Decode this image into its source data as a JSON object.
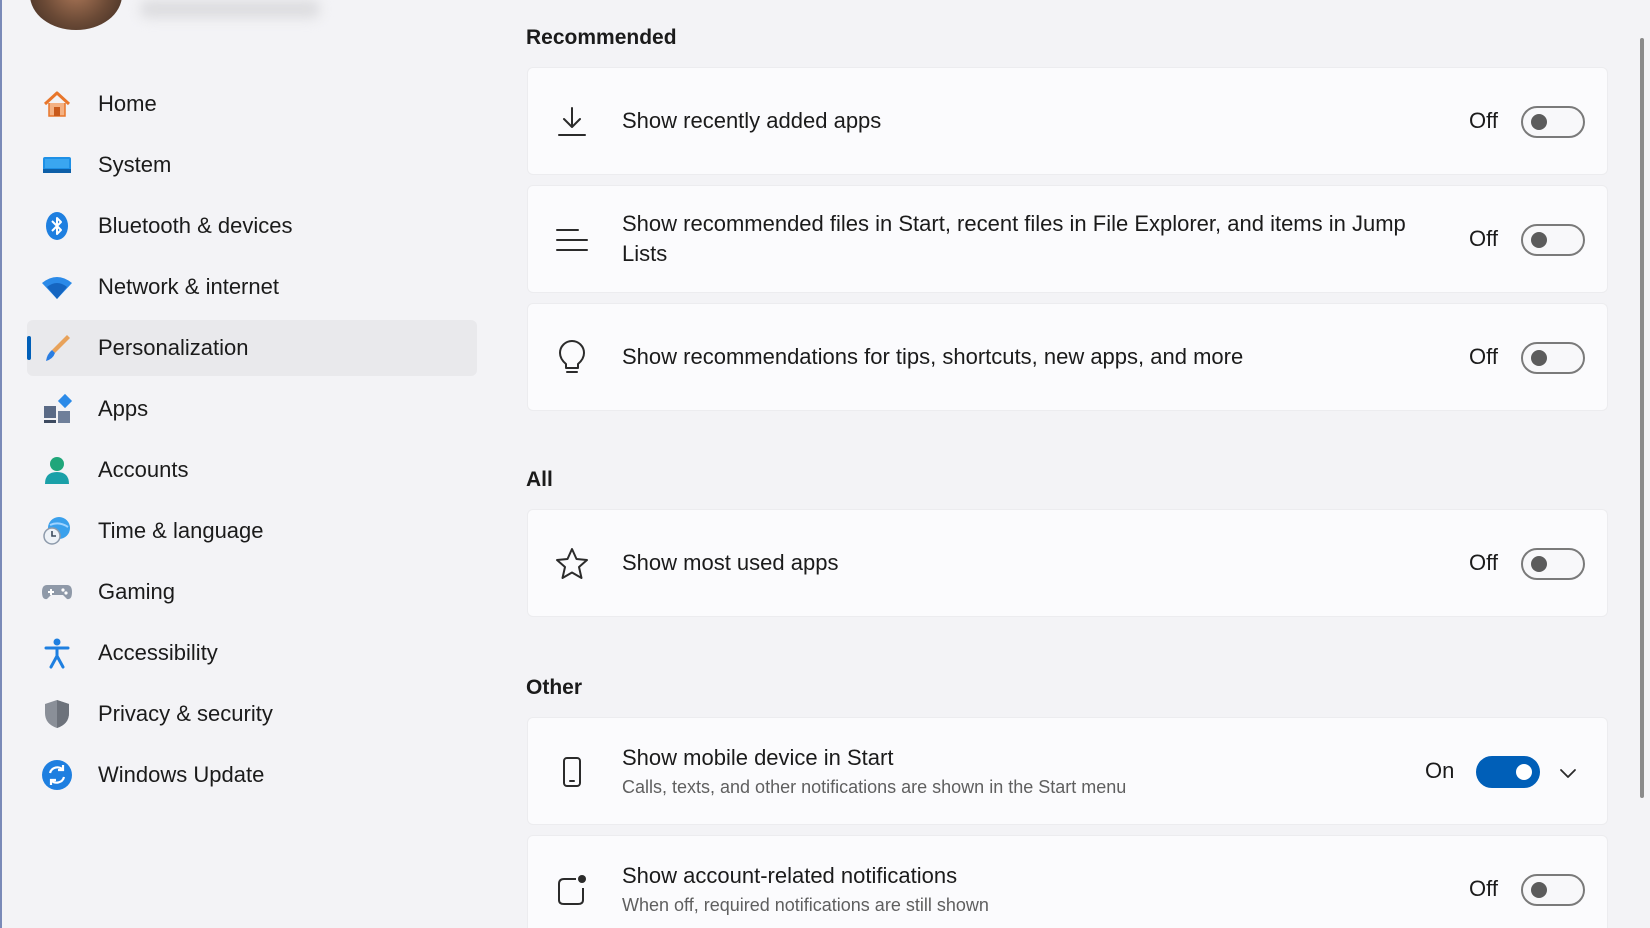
{
  "sidebar": {
    "items": [
      {
        "label": "Home",
        "icon": "home-icon"
      },
      {
        "label": "System",
        "icon": "system-icon"
      },
      {
        "label": "Bluetooth & devices",
        "icon": "bluetooth-icon"
      },
      {
        "label": "Network & internet",
        "icon": "wifi-icon"
      },
      {
        "label": "Personalization",
        "icon": "paintbrush-icon",
        "active": true
      },
      {
        "label": "Apps",
        "icon": "apps-icon"
      },
      {
        "label": "Accounts",
        "icon": "person-icon"
      },
      {
        "label": "Time & language",
        "icon": "globe-clock-icon"
      },
      {
        "label": "Gaming",
        "icon": "gamepad-icon"
      },
      {
        "label": "Accessibility",
        "icon": "accessibility-icon"
      },
      {
        "label": "Privacy & security",
        "icon": "shield-icon"
      },
      {
        "label": "Windows Update",
        "icon": "update-icon"
      }
    ]
  },
  "main": {
    "sections": {
      "recommended": "Recommended",
      "all": "All",
      "other": "Other"
    },
    "settings": {
      "recently_added": {
        "title": "Show recently added apps",
        "state": "Off",
        "icon": "download-icon"
      },
      "recommended_files": {
        "title": "Show recommended files in Start, recent files in File Explorer, and items in Jump Lists",
        "state": "Off",
        "icon": "lines-icon"
      },
      "recommendations_tips": {
        "title": "Show recommendations for tips, shortcuts, new apps, and more",
        "state": "Off",
        "icon": "lightbulb-icon"
      },
      "most_used": {
        "title": "Show most used apps",
        "state": "Off",
        "icon": "star-icon"
      },
      "mobile_device": {
        "title": "Show mobile device in Start",
        "subtitle": "Calls, texts, and other notifications are shown in the Start menu",
        "state": "On",
        "icon": "phone-icon",
        "expandable": true
      },
      "account_notifications": {
        "title": "Show account-related notifications",
        "subtitle": "When off, required notifications are still shown",
        "state": "Off",
        "icon": "notification-badge-icon"
      }
    }
  },
  "colors": {
    "accent": "#005fb8",
    "background": "#f3f3f6",
    "card": "#fbfbfd"
  }
}
